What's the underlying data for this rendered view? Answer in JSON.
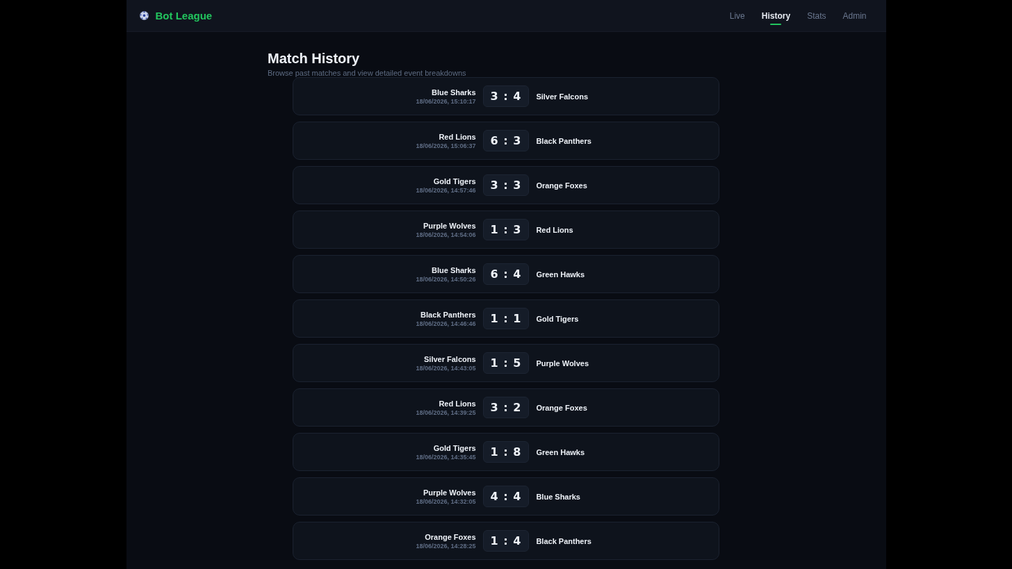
{
  "header": {
    "brand": "Bot League",
    "nav": [
      {
        "label": "Live",
        "selected": false
      },
      {
        "label": "History",
        "selected": true
      },
      {
        "label": "Stats",
        "selected": false
      },
      {
        "label": "Admin",
        "selected": false
      }
    ]
  },
  "page": {
    "title": "Match History",
    "subtitle": "Browse past matches and view detailed event breakdowns"
  },
  "matches": [
    {
      "home": "Blue Sharks",
      "time": "18/06/2026, 15:10:17",
      "score": "3 : 4",
      "away": "Silver Falcons"
    },
    {
      "home": "Red Lions",
      "time": "18/06/2026, 15:06:37",
      "score": "6 : 3",
      "away": "Black Panthers"
    },
    {
      "home": "Gold Tigers",
      "time": "18/06/2026, 14:57:46",
      "score": "3 : 3",
      "away": "Orange Foxes"
    },
    {
      "home": "Purple Wolves",
      "time": "18/06/2026, 14:54:06",
      "score": "1 : 3",
      "away": "Red Lions"
    },
    {
      "home": "Blue Sharks",
      "time": "18/06/2026, 14:50:26",
      "score": "6 : 4",
      "away": "Green Hawks"
    },
    {
      "home": "Black Panthers",
      "time": "18/06/2026, 14:46:46",
      "score": "1 : 1",
      "away": "Gold Tigers"
    },
    {
      "home": "Silver Falcons",
      "time": "18/06/2026, 14:43:05",
      "score": "1 : 5",
      "away": "Purple Wolves"
    },
    {
      "home": "Red Lions",
      "time": "18/06/2026, 14:39:25",
      "score": "3 : 2",
      "away": "Orange Foxes"
    },
    {
      "home": "Gold Tigers",
      "time": "18/06/2026, 14:35:45",
      "score": "1 : 8",
      "away": "Green Hawks"
    },
    {
      "home": "Purple Wolves",
      "time": "18/06/2026, 14:32:05",
      "score": "4 : 4",
      "away": "Blue Sharks"
    },
    {
      "home": "Orange Foxes",
      "time": "18/06/2026, 14:28:25",
      "score": "1 : 4",
      "away": "Black Panthers"
    }
  ]
}
